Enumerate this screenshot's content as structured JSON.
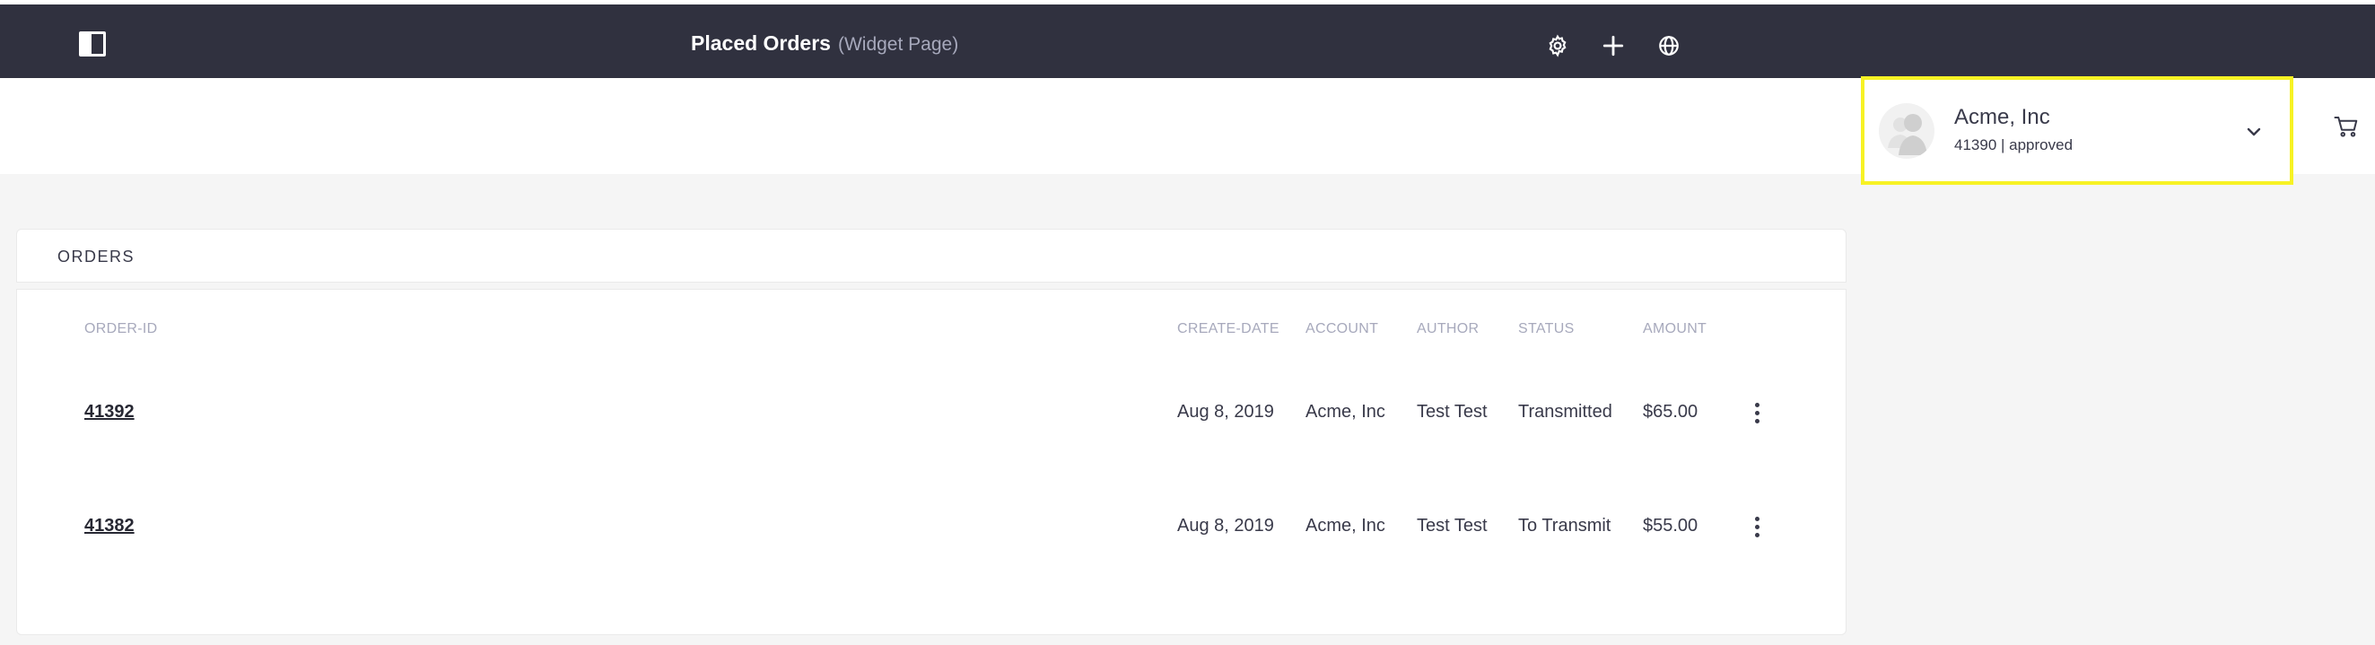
{
  "control_bar": {
    "title": "Placed Orders",
    "subtitle": "(Widget Page)",
    "icons": [
      "sidebar-toggle-icon",
      "gear-icon",
      "plus-icon",
      "simulation-icon"
    ]
  },
  "account": {
    "name": "Acme, Inc",
    "meta": "41390 | approved",
    "highlight_color": "#f7f224"
  },
  "orders": {
    "heading": "ORDERS",
    "columns": {
      "order_id": "ORDER-ID",
      "create_date": "CREATE-DATE",
      "account": "ACCOUNT",
      "author": "AUTHOR",
      "status": "STATUS",
      "amount": "AMOUNT"
    },
    "rows": [
      {
        "order_id": "41392",
        "create_date": "Aug 8, 2019",
        "account": "Acme, Inc",
        "author": "Test Test",
        "status": "Transmitted",
        "amount": "$65.00"
      },
      {
        "order_id": "41382",
        "create_date": "Aug 8, 2019",
        "account": "Acme, Inc",
        "author": "Test Test",
        "status": "To Transmit",
        "amount": "$55.00"
      }
    ]
  },
  "colors": {
    "control_bar_bg": "#30313f",
    "page_bg": "#f5f5f5",
    "text": "#393a4a",
    "muted": "#a7a9bc"
  }
}
